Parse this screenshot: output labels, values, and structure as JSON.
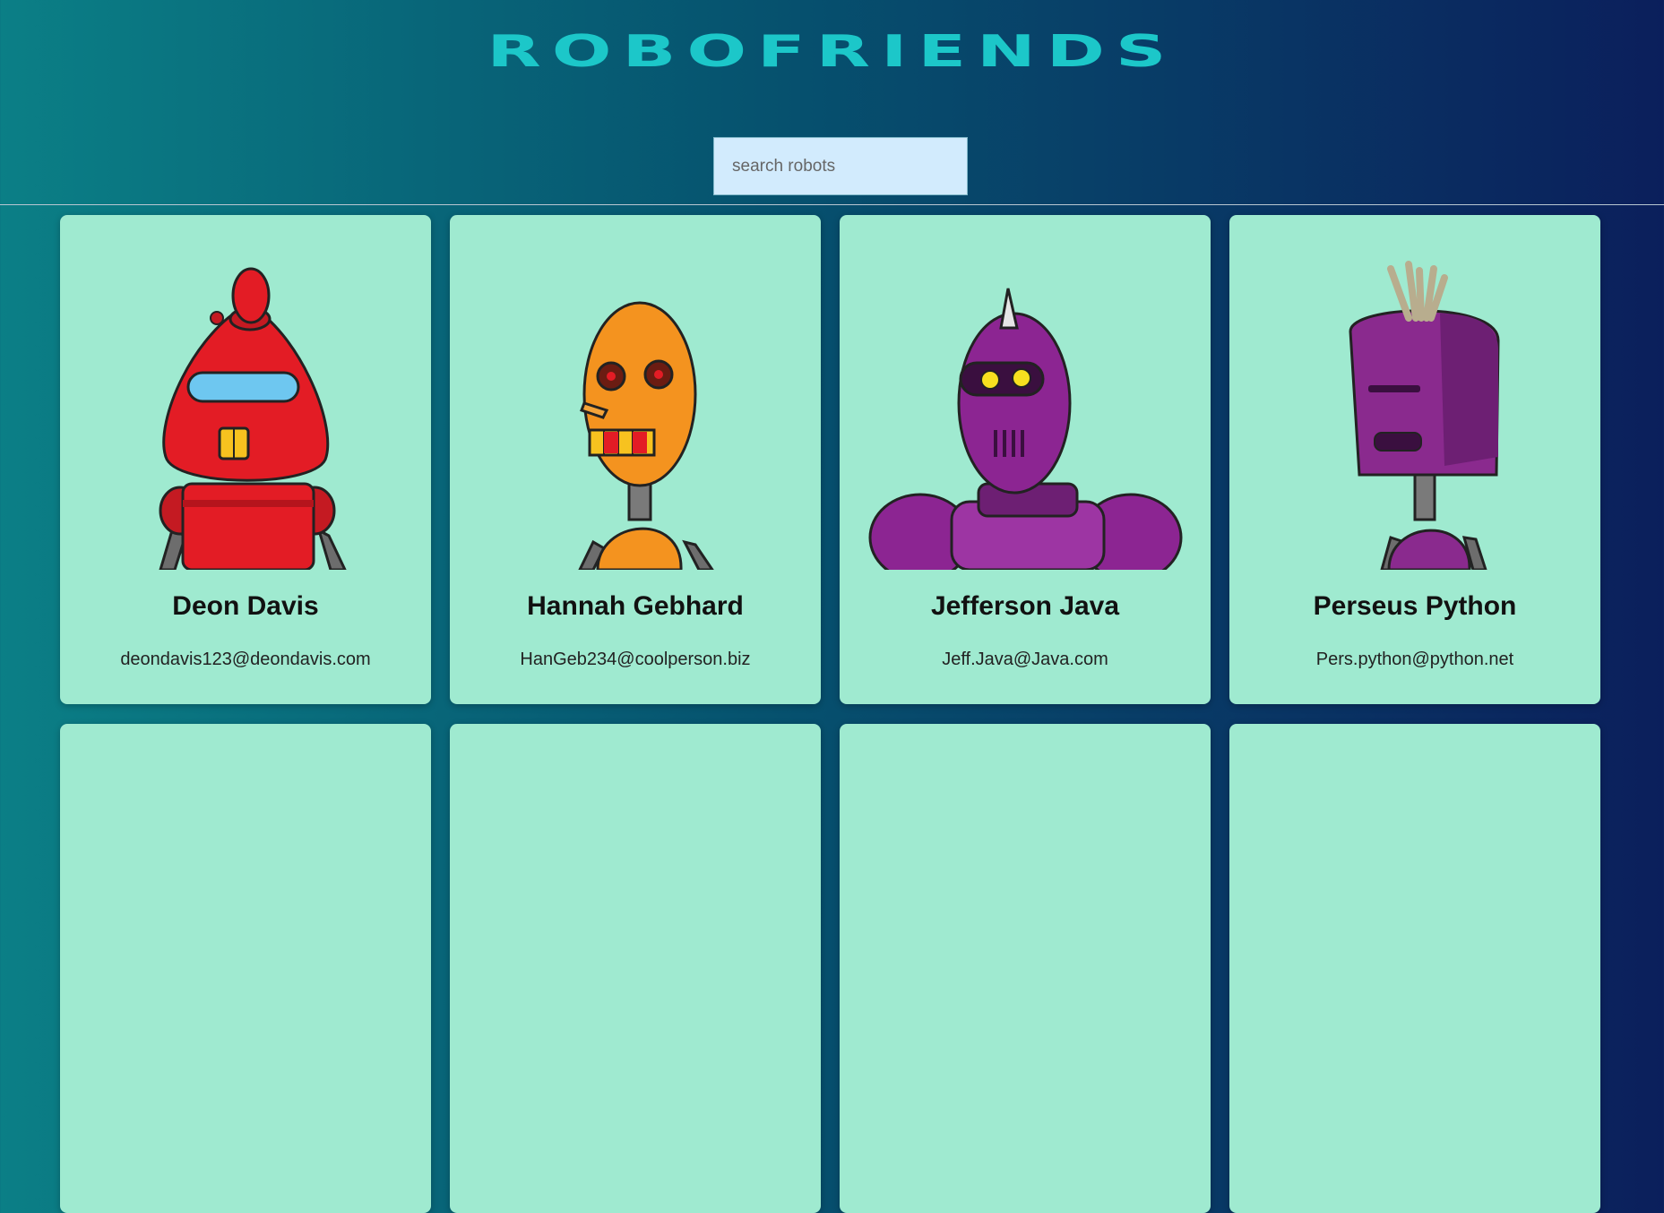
{
  "app": {
    "title": "ROBOFRIENDS"
  },
  "search": {
    "placeholder": "search robots",
    "value": ""
  },
  "robots": [
    {
      "name": "Deon Davis",
      "email": "deondavis123@deondavis.com",
      "color": "#e31c25"
    },
    {
      "name": "Hannah Gebhard",
      "email": "HanGeb234@coolperson.biz",
      "color": "#f4931f"
    },
    {
      "name": "Jefferson Java",
      "email": "Jeff.Java@Java.com",
      "color": "#8c2592"
    },
    {
      "name": "Perseus Python",
      "email": "Pers.python@python.net",
      "color": "#8a2a8e"
    }
  ],
  "colors": {
    "title": "#1cc7c9",
    "card_background": "#9fead0",
    "search_background": "#d2ebfd"
  }
}
